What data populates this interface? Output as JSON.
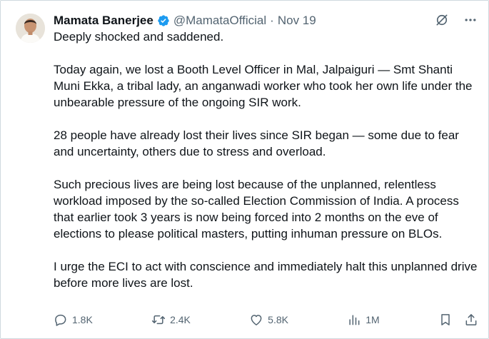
{
  "author": {
    "name": "Mamata Banerjee",
    "handle": "@MamataOfficial",
    "separator": "·",
    "date": "Nov 19",
    "verified": true
  },
  "tweet": {
    "paragraphs": [
      "Deeply shocked and saddened.",
      "Today again, we lost a Booth Level Officer in Mal, Jalpaiguri — Smt Shanti Muni Ekka, a tribal lady, an anganwadi worker who took her own life under the unbearable pressure of the ongoing SIR work.",
      "28 people have already lost their lives since SIR began — some due to fear and uncertainty, others due to stress and overload.",
      "Such precious lives are being lost because of the unplanned, relentless workload imposed by the so-called Election Commission of India. A process that earlier took 3 years is now being forced into 2 months on the eve of elections to please political masters, putting inhuman pressure on BLOs.",
      "I urge the ECI to act with conscience and immediately halt this unplanned drive before more lives are lost."
    ]
  },
  "metrics": {
    "replies": "1.8K",
    "reposts": "2.4K",
    "likes": "5.8K",
    "views": "1M"
  },
  "icons": {
    "top": [
      "grok-icon",
      "more-icon"
    ],
    "actions": [
      "reply-icon",
      "repost-icon",
      "like-icon",
      "views-icon",
      "bookmark-icon",
      "share-icon"
    ]
  },
  "colors": {
    "text": "#0f1419",
    "muted": "#536471",
    "verified": "#1d9bf0",
    "border": "#cfd9de"
  }
}
